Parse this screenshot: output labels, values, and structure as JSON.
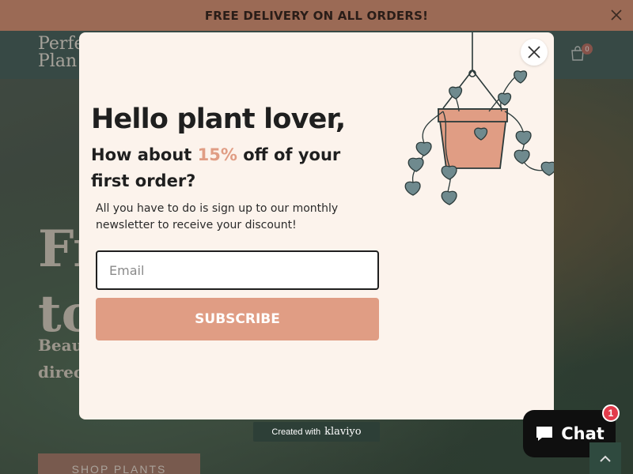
{
  "announcement": {
    "text": "FREE DELIVERY ON ALL ORDERS!"
  },
  "header": {
    "logo_line1": "Perfe",
    "logo_line2": "Plan",
    "cart_count": "0"
  },
  "hero": {
    "title_line1": "Fr",
    "title_line2": "to",
    "subtitle_line1": "Beau",
    "subtitle_line2": "direc",
    "shop_button": "SHOP PLANTS"
  },
  "popup": {
    "heading": "Hello plant lover,",
    "offer_pre": "How about ",
    "offer_accent": "15%",
    "offer_post": " off of your first order?",
    "description": "All you have to do is sign up to our monthly newsletter to receive your discount!",
    "email_placeholder": "Email",
    "subscribe_label": "SUBSCRIBE"
  },
  "klaviyo": {
    "prefix": "Created with",
    "brand": "klaviyo"
  },
  "chat": {
    "label": "Chat",
    "badge": "1"
  },
  "colors": {
    "accent": "#e09d84",
    "popup_bg": "#fcf3ec",
    "announcement_bg": "#9b6a55",
    "chat_badge": "#e23b4b"
  },
  "icons": {
    "close": "close-icon",
    "cart": "cart-icon",
    "plant": "hanging-plant-icon",
    "chat": "chat-bubble-icon",
    "scroll": "chevron-up-icon"
  }
}
